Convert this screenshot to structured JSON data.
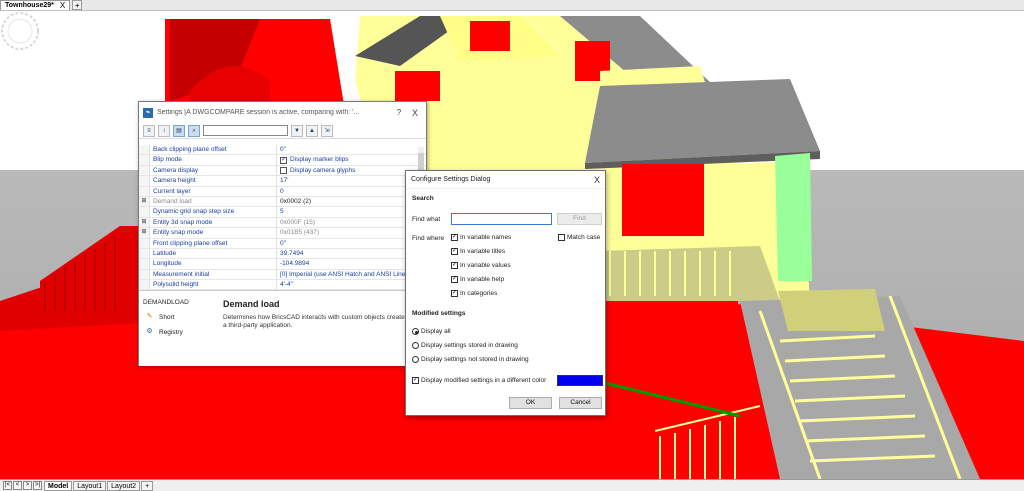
{
  "doc_tabs": {
    "active": "Townhouse29*",
    "close_glyph": "X",
    "add_glyph": "+"
  },
  "layout_tabs": {
    "nav_buttons": [
      "|<",
      "<",
      ">",
      ">|"
    ],
    "tabs": [
      "Model",
      "Layout1",
      "Layout2"
    ],
    "add_glyph": "+"
  },
  "settings": {
    "title": "Settings [A DWGCOMPARE session is active, comparing with: '...",
    "help_glyph": "?",
    "close_glyph": "X",
    "toolbar_icons": [
      "filter-icon",
      "sort-icon",
      "categorized-icon",
      "search-settings-icon",
      "collapse-icon",
      "expand-icon",
      "export-icon"
    ],
    "rows": [
      {
        "exp": "",
        "name": "Back clipping plane offset",
        "value": "0\"",
        "name_state": "normal",
        "value_state": "normal",
        "checkbox": null
      },
      {
        "exp": "",
        "name": "Blip mode",
        "value": "Display marker blips",
        "name_state": "normal",
        "value_state": "normal",
        "checkbox": true
      },
      {
        "exp": "",
        "name": "Camera display",
        "value": "Display camera glyphs",
        "name_state": "normal",
        "value_state": "normal",
        "checkbox": false
      },
      {
        "exp": "",
        "name": "Camera height",
        "value": "17'",
        "name_state": "normal",
        "value_state": "normal",
        "checkbox": null
      },
      {
        "exp": "",
        "name": "Current layer",
        "value": "0",
        "name_state": "normal",
        "value_state": "normal",
        "checkbox": null
      },
      {
        "exp": "⊞",
        "name": "Demand load",
        "value": "0x0002 (2)",
        "name_state": "disabled",
        "value_state": "black",
        "checkbox": null
      },
      {
        "exp": "",
        "name": "Dynamic grid snap step size",
        "value": "5",
        "name_state": "normal",
        "value_state": "normal",
        "checkbox": null
      },
      {
        "exp": "⊞",
        "name": "Entity 3d snap mode",
        "value": "0x000F (15)",
        "name_state": "normal",
        "value_state": "muted",
        "checkbox": null
      },
      {
        "exp": "⊞",
        "name": "Entity snap mode",
        "value": "0x01B5 (437)",
        "name_state": "normal",
        "value_state": "muted",
        "checkbox": null
      },
      {
        "exp": "",
        "name": "Front clipping plane offset",
        "value": "0\"",
        "name_state": "normal",
        "value_state": "normal",
        "checkbox": null
      },
      {
        "exp": "",
        "name": "Latitude",
        "value": "39.7494",
        "name_state": "normal",
        "value_state": "normal",
        "checkbox": null
      },
      {
        "exp": "",
        "name": "Longitude",
        "value": "-104.9894",
        "name_state": "normal",
        "value_state": "normal",
        "checkbox": null
      },
      {
        "exp": "",
        "name": "Measurement initial",
        "value": "[0] Imperial (use ANSI Hatch and ANSI Line",
        "name_state": "normal",
        "value_state": "normal",
        "checkbox": null
      },
      {
        "exp": "",
        "name": "Polysolid height",
        "value": "4'-4\"",
        "name_state": "normal",
        "value_state": "normal",
        "checkbox": null
      }
    ],
    "help": {
      "section": "DEMANDLOAD",
      "links": [
        {
          "icon": "short-description-icon",
          "label": "Short"
        },
        {
          "icon": "registry-icon",
          "label": "Registry"
        }
      ],
      "title": "Demand load",
      "description": "Determines how BricsCAD interacts with custom objects created by a third-party application."
    }
  },
  "dialog": {
    "title": "Configure Settings Dialog",
    "close_glyph": "X",
    "search_heading": "Search",
    "find_what_label": "Find what",
    "find_what_value": "",
    "find_button": "Find",
    "find_where_label": "Find where",
    "find_where_options": [
      {
        "label": "In variable names",
        "checked": true
      },
      {
        "label": "In variable titles",
        "checked": true
      },
      {
        "label": "In variable values",
        "checked": true
      },
      {
        "label": "In variable help",
        "checked": true
      },
      {
        "label": "In categories",
        "checked": true
      }
    ],
    "match_case": {
      "label": "Match case",
      "checked": false
    },
    "modified_heading": "Modified settings",
    "modified_options": [
      {
        "label": "Display all",
        "selected": true
      },
      {
        "label": "Display settings stored in drawing",
        "selected": false
      },
      {
        "label": "Display settings not stored in drawing",
        "selected": false
      }
    ],
    "display_modified": {
      "label": "Display modified settings in a different color",
      "checked": true
    },
    "modified_color": "#0000ee",
    "ok_button": "OK",
    "cancel_button": "Cancel"
  },
  "colors": {
    "model_red": "#ff0000",
    "model_yellow": "#ffff99",
    "model_gray": "#8c8c8c",
    "model_green": "#99ff99",
    "link_blue": "#1a3fa0"
  }
}
